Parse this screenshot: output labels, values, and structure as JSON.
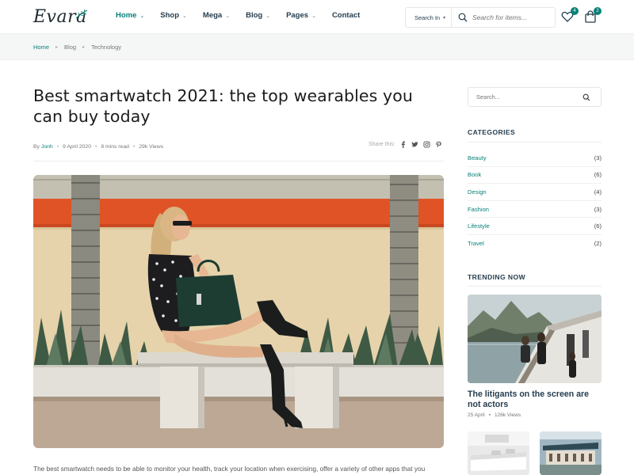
{
  "header": {
    "logo": "Evara",
    "nav": [
      {
        "label": "Home",
        "dropdown": true,
        "active": true
      },
      {
        "label": "Shop",
        "dropdown": true
      },
      {
        "label": "Mega",
        "dropdown": true
      },
      {
        "label": "Blog",
        "dropdown": true
      },
      {
        "label": "Pages",
        "dropdown": true
      },
      {
        "label": "Contact",
        "dropdown": false
      }
    ],
    "search": {
      "category_label": "Search In",
      "placeholder": "Search for items..."
    },
    "wishlist_count": "4",
    "cart_count": "2",
    "accent_color": "#088178"
  },
  "breadcrumb": {
    "home": "Home",
    "items": [
      "Blog",
      "Technology"
    ]
  },
  "article": {
    "title": "Best smartwatch 2021: the top wearables you can buy today",
    "meta": {
      "by": "By",
      "author": "Jonh",
      "date": "9 April 2020",
      "read_time": "8 mins read",
      "views": "29k Views"
    },
    "share_label": "Share this:",
    "share_icons": [
      "facebook-icon",
      "twitter-icon",
      "instagram-icon",
      "pinterest-icon"
    ],
    "intro": "The best smartwatch needs to be able to monitor your health, track your location when exercising, offer a variety of other apps that you"
  },
  "sidebar": {
    "search_placeholder": "Search...",
    "categories_heading": "CATEGORIES",
    "categories": [
      {
        "name": "Beauty",
        "count": "(3)"
      },
      {
        "name": "Book",
        "count": "(6)"
      },
      {
        "name": "Design",
        "count": "(4)"
      },
      {
        "name": "Fashion",
        "count": "(3)"
      },
      {
        "name": "Lifestyle",
        "count": "(6)"
      },
      {
        "name": "Travel",
        "count": "(2)"
      }
    ],
    "trending_heading": "TRENDING NOW",
    "trending": {
      "title": "The litigants on the screen are not actors",
      "date": "25 April",
      "views": "126k Views"
    }
  }
}
